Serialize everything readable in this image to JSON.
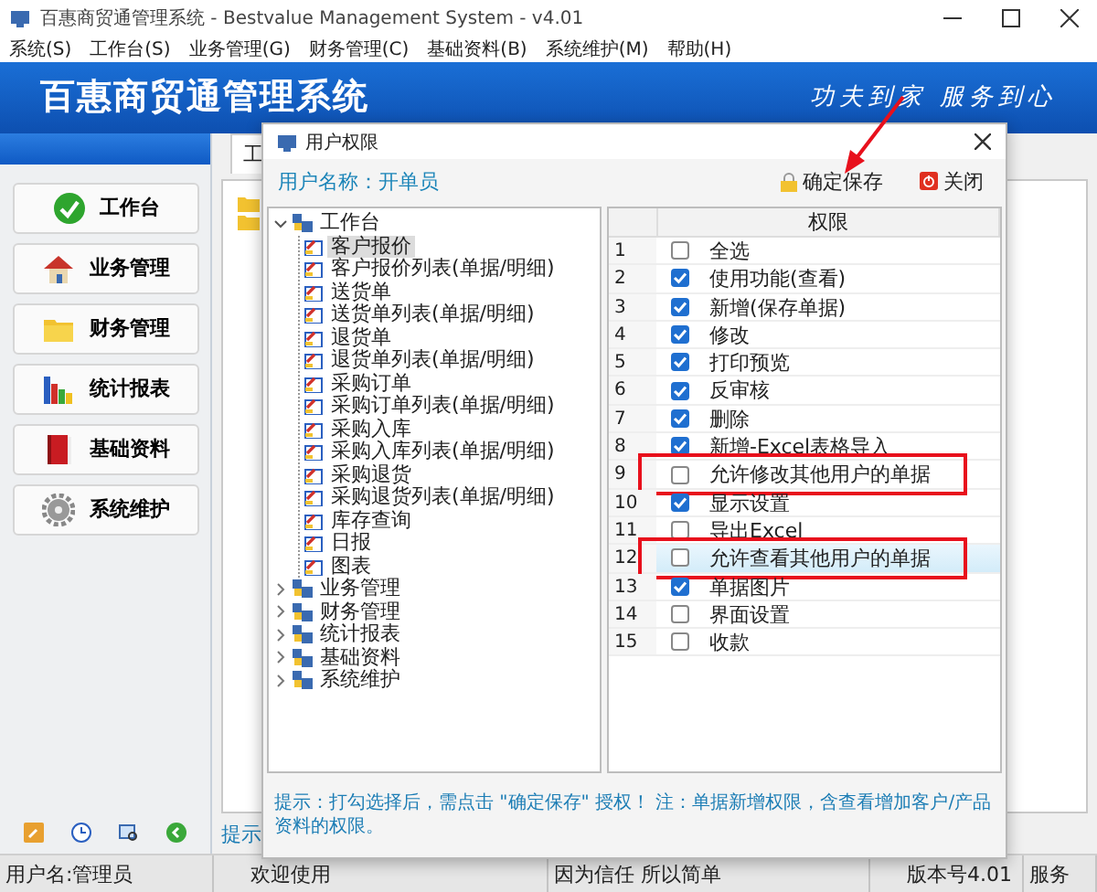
{
  "window": {
    "title": "百惠商贸通管理系统 - Bestvalue Management System - v4.01"
  },
  "menu": [
    "系统(S)",
    "工作台(S)",
    "业务管理(G)",
    "财务管理(C)",
    "基础资料(B)",
    "系统维护(M)",
    "帮助(H)"
  ],
  "banner": {
    "title": "百惠商贸通管理系统",
    "slogan": "功夫到家 服务到心"
  },
  "sidebar": {
    "items": [
      {
        "label": "工作台"
      },
      {
        "label": "业务管理"
      },
      {
        "label": "财务管理"
      },
      {
        "label": "统计报表"
      },
      {
        "label": "基础资料"
      },
      {
        "label": "系统维护"
      }
    ]
  },
  "main": {
    "tabs": [
      {
        "label": "工",
        "selected": true
      }
    ],
    "hint": "提示"
  },
  "dialog": {
    "title": "用户权限",
    "user": "用户名称：开单员",
    "buttons": [
      {
        "label": "确定保存",
        "kind": "save"
      },
      {
        "label": "关闭",
        "kind": "close"
      }
    ],
    "tree": [
      {
        "label": "工作台",
        "expanded": true,
        "selected": false,
        "children": [
          {
            "label": "客户报价",
            "selected": true
          },
          {
            "label": "客户报价列表(单据/明细)",
            "selected": false
          },
          {
            "label": "送货单",
            "selected": false
          },
          {
            "label": "送货单列表(单据/明细)",
            "selected": false
          },
          {
            "label": "退货单",
            "selected": false
          },
          {
            "label": "退货单列表(单据/明细)",
            "selected": false
          },
          {
            "label": "采购订单",
            "selected": false
          },
          {
            "label": "采购订单列表(单据/明细)",
            "selected": false
          },
          {
            "label": "采购入库",
            "selected": false
          },
          {
            "label": "采购入库列表(单据/明细)",
            "selected": false
          },
          {
            "label": "采购退货",
            "selected": false
          },
          {
            "label": "采购退货列表(单据/明细)",
            "selected": false
          },
          {
            "label": "库存查询",
            "selected": false
          },
          {
            "label": "日报",
            "selected": false
          },
          {
            "label": "图表",
            "selected": false
          }
        ]
      },
      {
        "label": "业务管理",
        "expanded": false,
        "selected": false
      },
      {
        "label": "财务管理",
        "expanded": false,
        "selected": false
      },
      {
        "label": "统计报表",
        "expanded": false,
        "selected": false
      },
      {
        "label": "基础资料",
        "expanded": false,
        "selected": false
      },
      {
        "label": "系统维护",
        "expanded": false,
        "selected": false
      }
    ],
    "grid": {
      "header": "权限",
      "rows": [
        {
          "number": "1",
          "label": "全选",
          "checked": false,
          "selected": false,
          "boxed": false
        },
        {
          "number": "2",
          "label": "使用功能(查看)",
          "checked": true,
          "selected": false,
          "boxed": false
        },
        {
          "number": "3",
          "label": "新增(保存单据)",
          "checked": true,
          "selected": false,
          "boxed": false
        },
        {
          "number": "4",
          "label": "修改",
          "checked": true,
          "selected": false,
          "boxed": false
        },
        {
          "number": "5",
          "label": "打印预览",
          "checked": true,
          "selected": false,
          "boxed": false
        },
        {
          "number": "6",
          "label": "反审核",
          "checked": true,
          "selected": false,
          "boxed": false
        },
        {
          "number": "7",
          "label": "删除",
          "checked": true,
          "selected": false,
          "boxed": false
        },
        {
          "number": "8",
          "label": "新增-Excel表格导入",
          "checked": true,
          "selected": false,
          "boxed": false
        },
        {
          "number": "9",
          "label": "允许修改其他用户的单据",
          "checked": false,
          "selected": false,
          "boxed": true
        },
        {
          "number": "10",
          "label": "显示设置",
          "checked": true,
          "selected": false,
          "boxed": false
        },
        {
          "number": "11",
          "label": "导出Excel",
          "checked": false,
          "selected": false,
          "boxed": false
        },
        {
          "number": "12",
          "label": "允许查看其他用户的单据",
          "checked": false,
          "selected": true,
          "boxed": true
        },
        {
          "number": "13",
          "label": "单据图片",
          "checked": true,
          "selected": false,
          "boxed": false
        },
        {
          "number": "14",
          "label": "界面设置",
          "checked": false,
          "selected": false,
          "boxed": false
        },
        {
          "number": "15",
          "label": "收款",
          "checked": false,
          "selected": false,
          "boxed": false
        }
      ]
    },
    "hint": "提示：打勾选择后，需点击 \"确定保存\" 授权！ 注：单据新增权限，含查看增加客户/产品资料的权限。"
  },
  "status_bar": [
    "用户名:管理员",
    "欢迎使用",
    "因为信任 所以简单",
    "版本号4.01",
    "服务"
  ]
}
